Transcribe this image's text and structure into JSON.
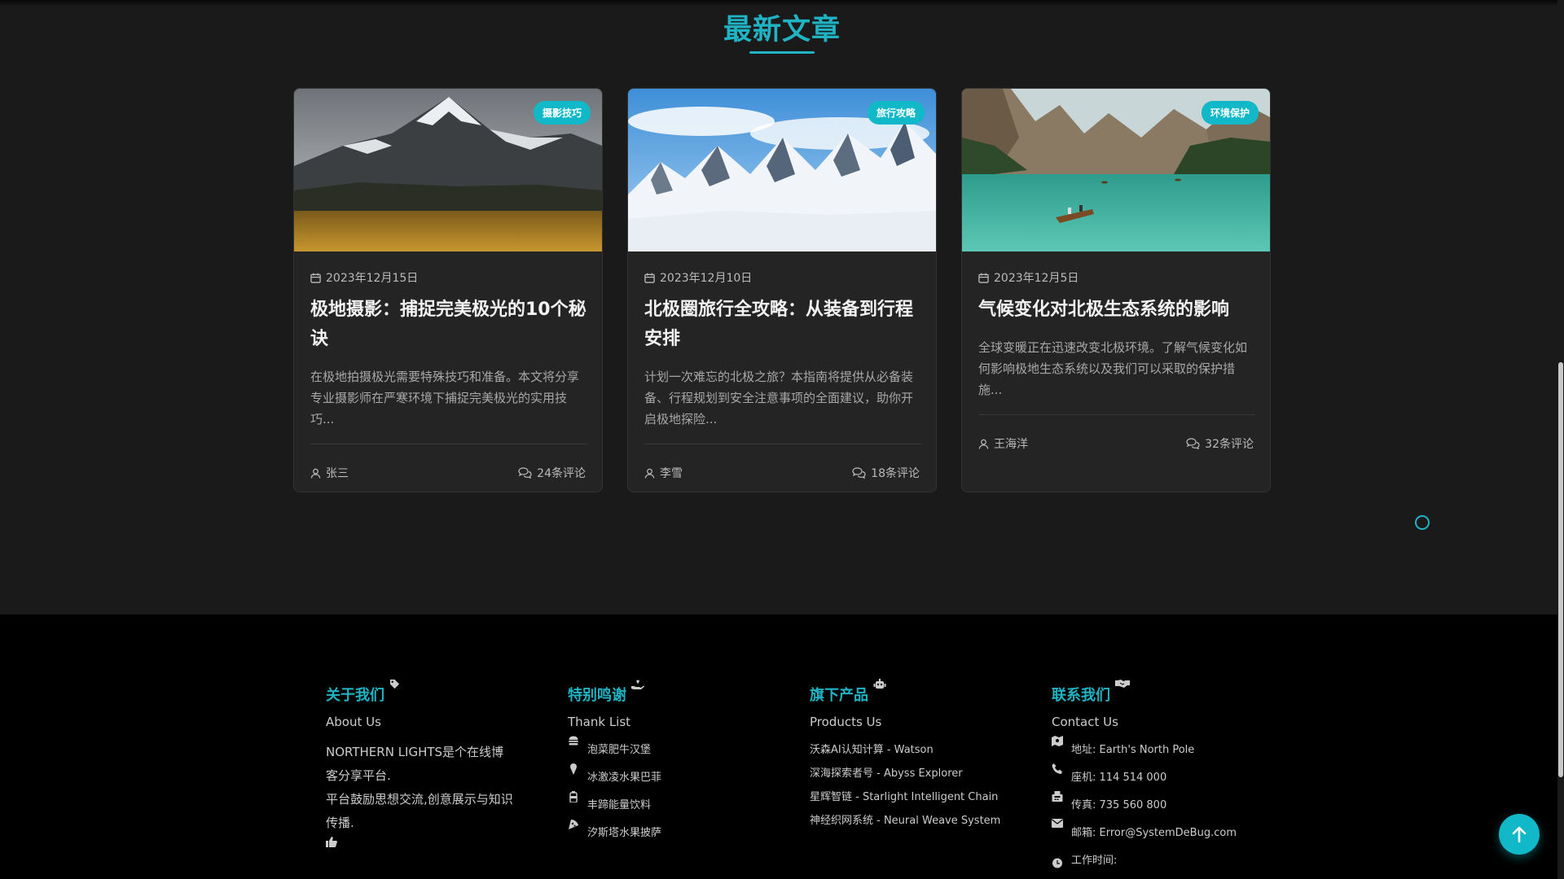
{
  "section": {
    "title": "最新文章"
  },
  "articles": [
    {
      "tag": "摄影技巧",
      "date": "2023年12月15日",
      "title": "极地摄影：捕捉完美极光的10个秘诀",
      "excerpt": "在极地拍摄极光需要特殊技巧和准备。本文将分享专业摄影师在严寒环境下捕捉完美极光的实用技巧...",
      "author": "张三",
      "comments": "24条评论"
    },
    {
      "tag": "旅行攻略",
      "date": "2023年12月10日",
      "title": "北极圈旅行全攻略：从装备到行程安排",
      "excerpt": "计划一次难忘的北极之旅？本指南将提供从必备装备、行程规划到安全注意事项的全面建议，助你开启极地探险...",
      "author": "李雪",
      "comments": "18条评论"
    },
    {
      "tag": "环境保护",
      "date": "2023年12月5日",
      "title": "气候变化对北极生态系统的影响",
      "excerpt": "全球变暖正在迅速改变北极环境。了解气候变化如何影响极地生态系统以及我们可以采取的保护措施...",
      "author": "王海洋",
      "comments": "32条评论"
    }
  ],
  "footer": {
    "about": {
      "title": "关于我们",
      "subtitle": "About Us",
      "line1": "NORTHERN LIGHTS是个在线博客分享平台.",
      "line2": "平台鼓励思想交流,创意展示与知识传播."
    },
    "thanks": {
      "title": "特别鸣谢",
      "subtitle": "Thank List",
      "items": [
        "泡菜肥牛汉堡",
        "冰激凌水果巴菲",
        "丰蹄能量饮料",
        "汐斯塔水果披萨"
      ]
    },
    "products": {
      "title": "旗下产品",
      "subtitle": "Products Us",
      "items": [
        "沃森AI认知计算 - Watson",
        "深海探索者号 - Abyss Explorer",
        "星辉智链 - Starlight Intelligent Chain",
        "神经织网系统 - Neural Weave System"
      ]
    },
    "contact": {
      "title": "联系我们",
      "subtitle": "Contact Us",
      "items": [
        "地址: Earth's North Pole",
        "座机: 114 514 000",
        "传真: 735 560 800",
        "邮箱: Error@SystemDeBug.com",
        "工作时间:"
      ]
    }
  },
  "colors": {
    "accent": "#1fb3c4",
    "tag_bg": "#10b8c8",
    "card_bg": "#242424",
    "footer_bg": "#000000"
  },
  "icons": [
    "calendar-icon",
    "user-icon",
    "comments-icon",
    "tag-icon",
    "hand-heart-icon",
    "robot-icon",
    "handshake-icon",
    "burger-icon",
    "ice-cream-icon",
    "bottle-icon",
    "pizza-icon",
    "map-icon",
    "phone-icon",
    "fax-icon",
    "mail-icon",
    "clock-icon",
    "thumbs-up-icon",
    "arrow-up-icon"
  ]
}
